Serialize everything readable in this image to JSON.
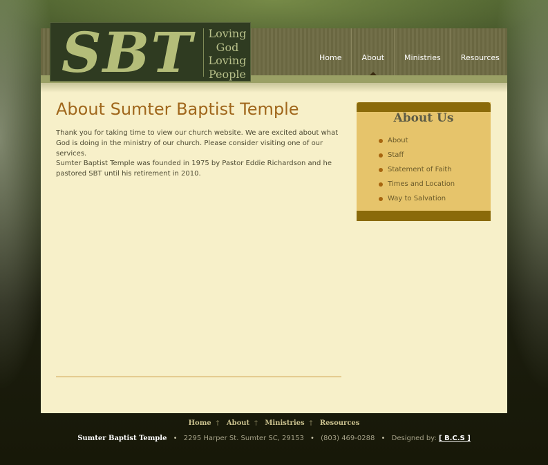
{
  "logo": {
    "mark": "SBT",
    "tagline": [
      "Loving",
      "God",
      "Loving",
      "People"
    ]
  },
  "nav": {
    "items": [
      {
        "label": "Home"
      },
      {
        "label": "About"
      },
      {
        "label": "Ministries"
      },
      {
        "label": "Resources"
      }
    ],
    "active": "About"
  },
  "main": {
    "title": "About Sumter Baptist Temple",
    "paragraphs": [
      "Thank you for taking time to view our church website. We are excited about what God is doing in the ministry of our church. Please consider visiting one of our services.",
      "Sumter Baptist Temple was founded in 1975 by Pastor Eddie Richardson and he pastored SBT until his retirement in 2010."
    ]
  },
  "sidebar": {
    "title": "About Us",
    "items": [
      "About",
      "Staff",
      "Statement of Faith",
      "Times and Location",
      "Way to Salvation"
    ]
  },
  "footer": {
    "nav": [
      "Home",
      "About",
      "Ministries",
      "Resources"
    ],
    "separator": "†",
    "org_name": "Sumter Baptist Temple",
    "address": "2295 Harper St. Sumter SC, 29153",
    "phone": "(803) 469-0288",
    "designed_by_label": "Designed by:",
    "designer": "[ B.C.S ]",
    "bullet": "•"
  },
  "colors": {
    "title": "#a0671c",
    "sidebar_bg": "#e6c46b",
    "sidebar_band": "#8a6a0a",
    "content_bg": "#f7f0c9",
    "logo_bg": "#2f3b21"
  }
}
